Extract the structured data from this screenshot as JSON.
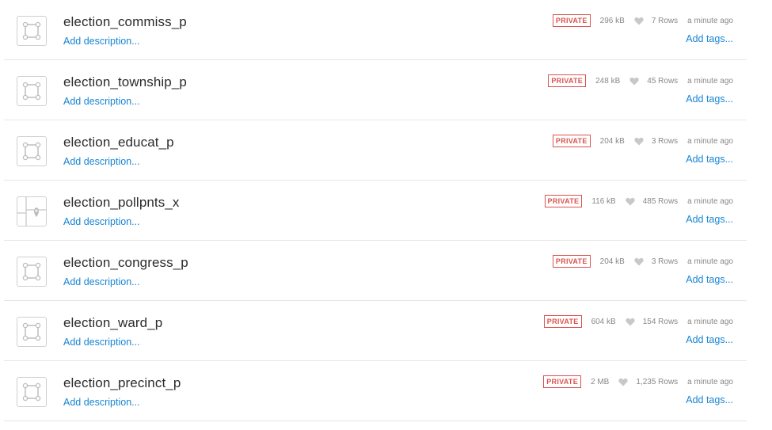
{
  "datasets": [
    {
      "name": "election_commiss_p",
      "description_link": "Add description...",
      "privacy": "PRIVATE",
      "size": "296 kB",
      "rows": "7 Rows",
      "updated": "a minute ago",
      "tags_link": "Add tags...",
      "icon": "polygon-icon"
    },
    {
      "name": "election_township_p",
      "description_link": "Add description...",
      "privacy": "PRIVATE",
      "size": "248 kB",
      "rows": "45 Rows",
      "updated": "a minute ago",
      "tags_link": "Add tags...",
      "icon": "polygon-icon"
    },
    {
      "name": "election_educat_p",
      "description_link": "Add description...",
      "privacy": "PRIVATE",
      "size": "204 kB",
      "rows": "3 Rows",
      "updated": "a minute ago",
      "tags_link": "Add tags...",
      "icon": "polygon-icon"
    },
    {
      "name": "election_pollpnts_x",
      "description_link": "Add description...",
      "privacy": "PRIVATE",
      "size": "116 kB",
      "rows": "485 Rows",
      "updated": "a minute ago",
      "tags_link": "Add tags...",
      "icon": "map-point-icon"
    },
    {
      "name": "election_congress_p",
      "description_link": "Add description...",
      "privacy": "PRIVATE",
      "size": "204 kB",
      "rows": "3 Rows",
      "updated": "a minute ago",
      "tags_link": "Add tags...",
      "icon": "polygon-icon"
    },
    {
      "name": "election_ward_p",
      "description_link": "Add description...",
      "privacy": "PRIVATE",
      "size": "604 kB",
      "rows": "154 Rows",
      "updated": "a minute ago",
      "tags_link": "Add tags...",
      "icon": "polygon-icon"
    },
    {
      "name": "election_precinct_p",
      "description_link": "Add description...",
      "privacy": "PRIVATE",
      "size": "2 MB",
      "rows": "1,235 Rows",
      "updated": "a minute ago",
      "tags_link": "Add tags...",
      "icon": "polygon-icon"
    }
  ],
  "colors": {
    "link": "#1785d4",
    "private_badge": "#d9534f",
    "meta_text": "#888888",
    "heart": "#c8c8c8"
  }
}
